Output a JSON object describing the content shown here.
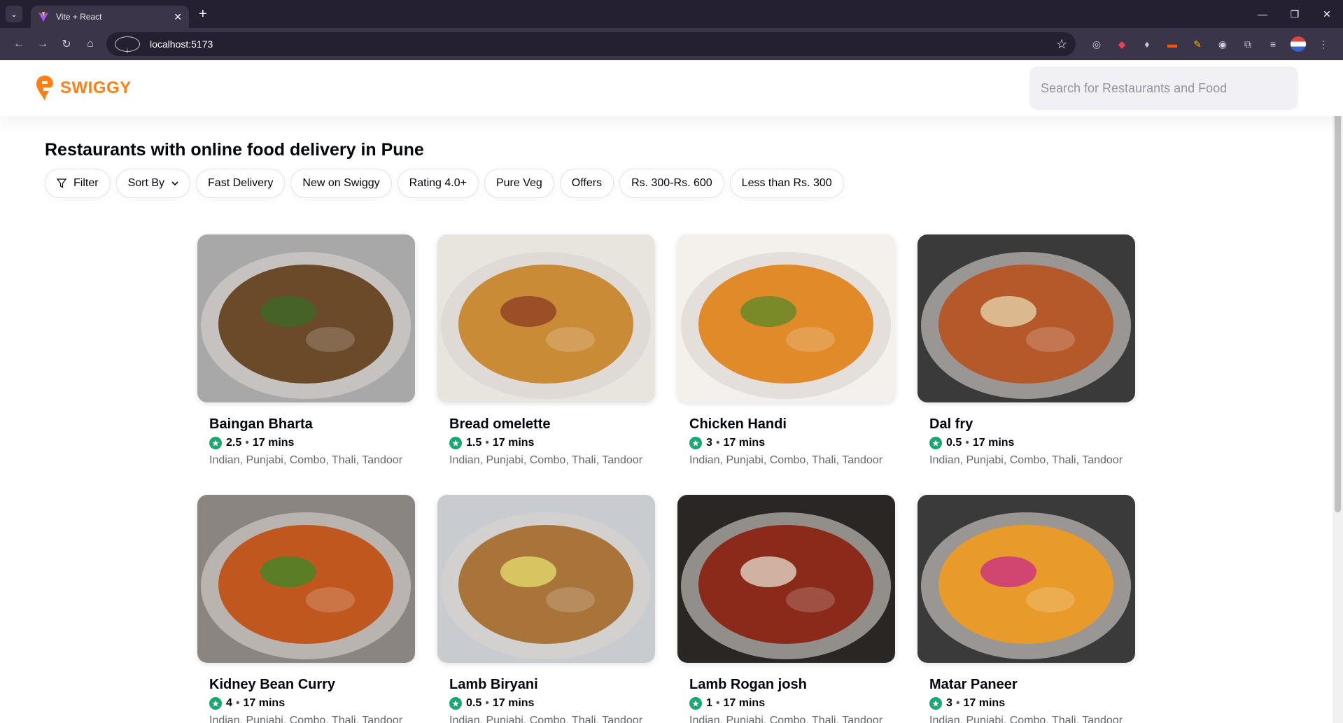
{
  "browser": {
    "tab_title": "Vite + React",
    "url": "localhost:5173"
  },
  "app": {
    "brand": "SWIGGY",
    "brand_color": "#fc8019",
    "search_placeholder": "Search for Restaurants and Food"
  },
  "heading": "Restaurants with online food delivery in Pune",
  "filters": [
    {
      "label": "Filter",
      "icon": "filter-icon"
    },
    {
      "label": "Sort By",
      "icon": "chevron-down-icon"
    },
    {
      "label": "Fast Delivery"
    },
    {
      "label": "New on Swiggy"
    },
    {
      "label": "Rating 4.0+"
    },
    {
      "label": "Pure Veg"
    },
    {
      "label": "Offers"
    },
    {
      "label": "Rs. 300-Rs. 600"
    },
    {
      "label": "Less than Rs. 300"
    }
  ],
  "restaurants": [
    {
      "name": "Baingan Bharta",
      "rating": "2.5",
      "time": "17 mins",
      "cuisines": "Indian, Punjabi, Combo, Thali, Tandoor",
      "colors": [
        "#6b4a2a",
        "#a8a8a8",
        "#3a6b2a"
      ]
    },
    {
      "name": "Bread omelette",
      "rating": "1.5",
      "time": "17 mins",
      "cuisines": "Indian, Punjabi, Combo, Thali, Tandoor",
      "colors": [
        "#c98b36",
        "#e8e4de",
        "#8c3a22"
      ]
    },
    {
      "name": "Chicken Handi",
      "rating": "3",
      "time": "17 mins",
      "cuisines": "Indian, Punjabi, Combo, Thali, Tandoor",
      "colors": [
        "#e08a2a",
        "#f4f0ec",
        "#5a8a2a"
      ]
    },
    {
      "name": "Dal fry",
      "rating": "0.5",
      "time": "17 mins",
      "cuisines": "Indian, Punjabi, Combo, Thali, Tandoor",
      "colors": [
        "#b5592a",
        "#3a3a3a",
        "#e8d8b0"
      ]
    },
    {
      "name": "Kidney Bean Curry",
      "rating": "4",
      "time": "17 mins",
      "cuisines": "Indian, Punjabi, Combo, Thali, Tandoor",
      "colors": [
        "#c0571f",
        "#8a8580",
        "#3a8a2a"
      ]
    },
    {
      "name": "Lamb Biryani",
      "rating": "0.5",
      "time": "17 mins",
      "cuisines": "Indian, Punjabi, Combo, Thali, Tandoor",
      "colors": [
        "#a8743a",
        "#c8ccd0",
        "#e8e070"
      ]
    },
    {
      "name": "Lamb Rogan josh",
      "rating": "1",
      "time": "17 mins",
      "cuisines": "Indian, Punjabi, Combo, Thali, Tandoor",
      "colors": [
        "#8a2a1a",
        "#2a2624",
        "#e8e0d0"
      ]
    },
    {
      "name": "Matar Paneer",
      "rating": "3",
      "time": "17 mins",
      "cuisines": "Indian, Punjabi, Combo, Thali, Tandoor",
      "colors": [
        "#e89a2a",
        "#3a3a3a",
        "#c82a8a"
      ]
    }
  ]
}
